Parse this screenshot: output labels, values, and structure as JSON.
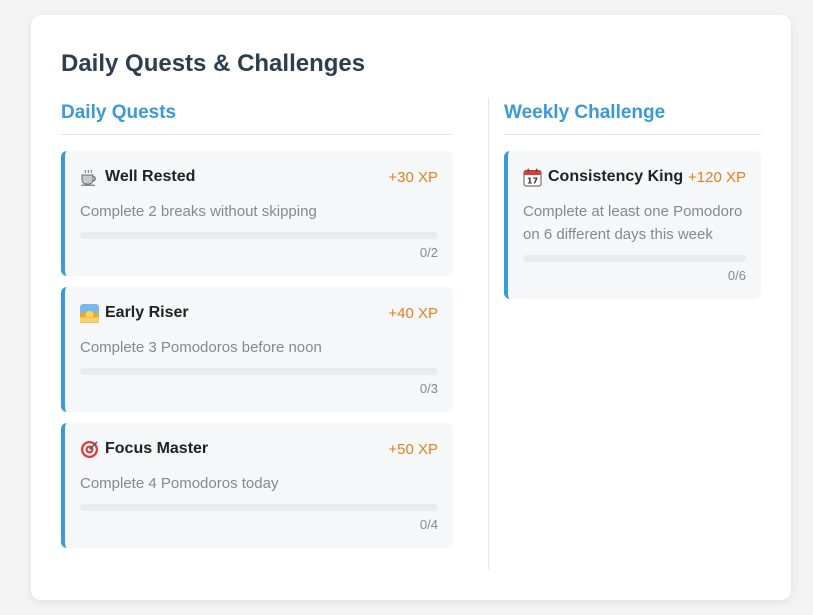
{
  "title": "Daily Quests & Challenges",
  "daily": {
    "heading": "Daily Quests",
    "quests": [
      {
        "icon": "coffee-icon",
        "name": "Well Rested",
        "xp": "+30 XP",
        "description": "Complete 2 breaks without skipping",
        "progress_text": "0/2",
        "progress": 0
      },
      {
        "icon": "sunrise-icon",
        "name": "Early Riser",
        "xp": "+40 XP",
        "description": "Complete 3 Pomodoros before noon",
        "progress_text": "0/3",
        "progress": 0
      },
      {
        "icon": "target-icon",
        "name": "Focus Master",
        "xp": "+50 XP",
        "description": "Complete 4 Pomodoros today",
        "progress_text": "0/4",
        "progress": 0
      }
    ]
  },
  "weekly": {
    "heading": "Weekly Challenge",
    "quests": [
      {
        "icon": "calendar-icon",
        "name": "Consistency King",
        "xp": "+120 XP",
        "description": "Complete at least one Pomodoro on 6 different days this week",
        "progress_text": "0/6",
        "progress": 0
      }
    ]
  },
  "colors": {
    "accent": "#3a9ad9",
    "xp": "#e67e22",
    "title": "#2c3e50",
    "muted": "#7f8c8d"
  }
}
